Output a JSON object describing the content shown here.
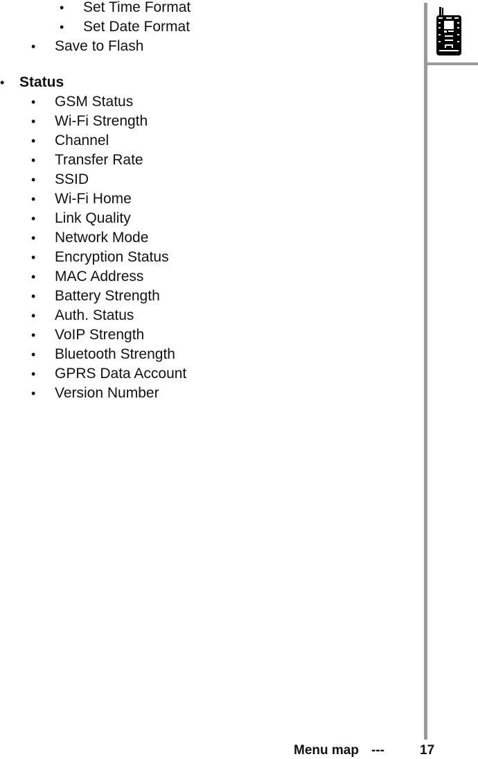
{
  "page": {
    "top_items": [
      {
        "label": "Set Time Format",
        "level": 3
      },
      {
        "label": "Set Date Format",
        "level": 3
      },
      {
        "label": "Save to Flash",
        "level": 2
      }
    ],
    "section": {
      "title": "Status",
      "items": [
        "GSM Status",
        "Wi-Fi Strength",
        "Channel",
        "Transfer Rate",
        "SSID",
        "Wi-Fi Home",
        "Link Quality",
        "Network Mode",
        "Encryption Status",
        "MAC Address",
        "Battery Strength",
        "Auth. Status",
        "VoIP Strength",
        "Bluetooth Strength",
        "GPRS Data Account",
        "Version Number"
      ]
    },
    "bullet": "•",
    "footer": {
      "section_name": "Menu map",
      "separator": "---",
      "page_number": "17"
    },
    "icon": "mobile-phone-icon",
    "rule_color": "#9a9a9a"
  }
}
